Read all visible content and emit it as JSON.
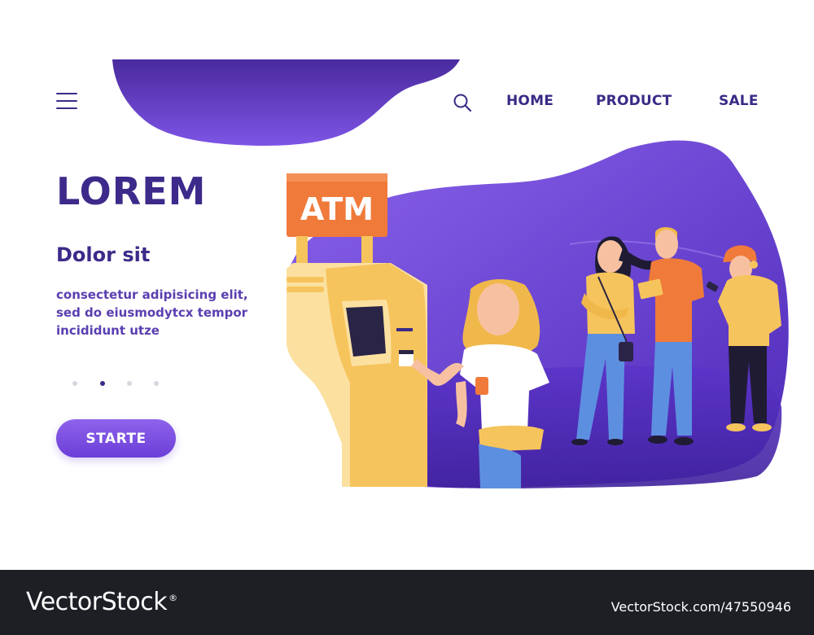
{
  "header": {
    "menu_icon": "hamburger-menu-icon",
    "search_icon": "search-icon",
    "nav": [
      "HOME",
      "PRODUCT",
      "SALE"
    ]
  },
  "hero": {
    "title": "LOREM",
    "subtitle": "Dolor sit",
    "body": "consectetur adipisicing elit, sed do eiusmodytcx tempor incididunt utze",
    "cta_label": "STARTE",
    "carousel": {
      "count": 4,
      "active_index": 1
    }
  },
  "illustration": {
    "atm_sign": "ATM"
  },
  "footer": {
    "logo": "VectorStock",
    "logo_mark": "®",
    "image_id": "VectorStock.com/47550946"
  },
  "colors": {
    "primary": "#3d2a8a",
    "accent": "#7c4fe3",
    "atm_orange": "#f07a3a",
    "atm_yellow": "#f6c45c",
    "footer_bg": "#1d1f25"
  }
}
